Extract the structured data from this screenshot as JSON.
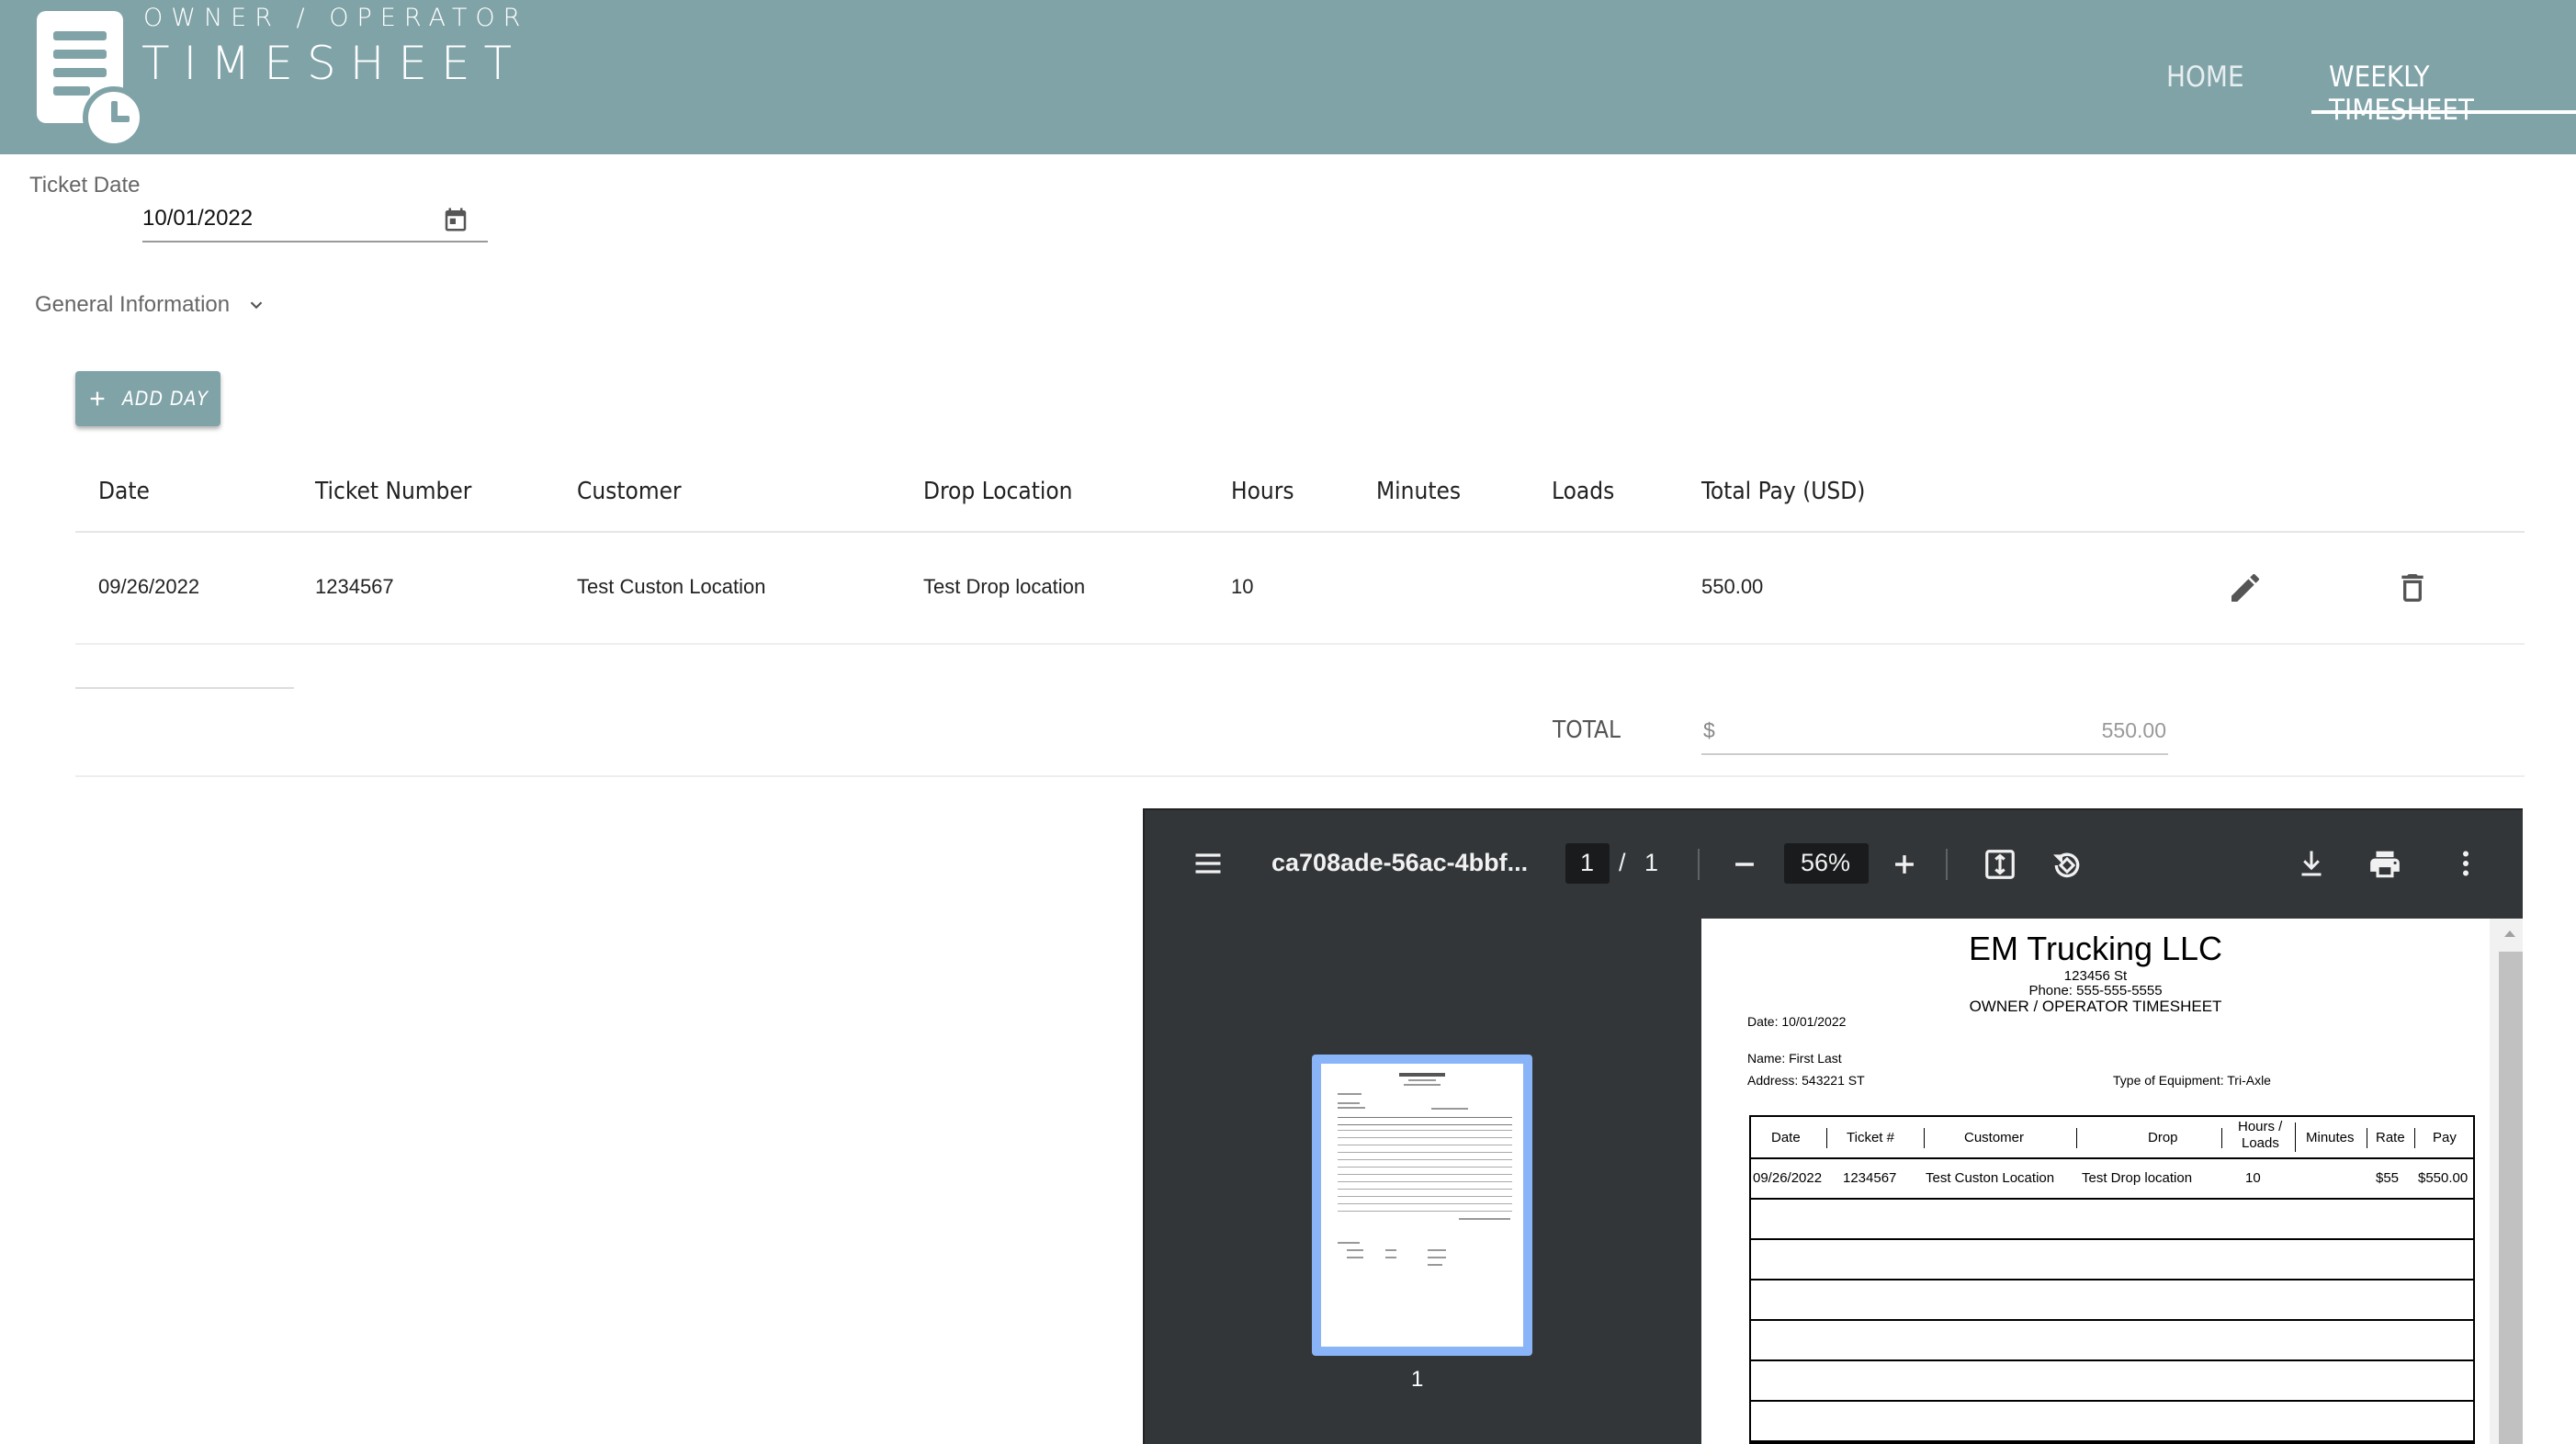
{
  "header": {
    "logo_subtitle": "OWNER / OPERATOR",
    "logo_title": "TIMESHEET",
    "nav": {
      "home": "HOME",
      "weekly": "WEEKLY TIMESHEET"
    }
  },
  "ticket_date": {
    "label": "Ticket Date",
    "value": "10/01/2022"
  },
  "general_info": {
    "label": "General Information"
  },
  "add_day_button": {
    "label": "ADD DAY"
  },
  "table": {
    "headers": [
      "Date",
      "Ticket Number",
      "Customer",
      "Drop Location",
      "Hours",
      "Minutes",
      "Loads",
      "Total Pay (USD)"
    ],
    "rows": [
      {
        "date": "09/26/2022",
        "ticket": "1234567",
        "customer": "Test Custon Location",
        "drop": "Test Drop location",
        "hours": "10",
        "minutes": "",
        "loads": "",
        "total_pay": "550.00"
      }
    ]
  },
  "total": {
    "label": "TOTAL",
    "currency": "$",
    "value": "550.00"
  },
  "pdf_viewer": {
    "filename": "ca708ade-56ac-4bbf...",
    "page_current": "1",
    "page_sep": "/",
    "page_total": "1",
    "zoom": "56%",
    "thumbnail_number": "1",
    "document": {
      "company": "EM Trucking LLC",
      "street": "123456 St",
      "phone": "Phone: 555-555-5555",
      "doc_title": "OWNER / OPERATOR TIMESHEET",
      "date": "Date: 10/01/2022",
      "name": "Name: First Last",
      "address": "Address: 543221 ST",
      "equipment": "Type of Equipment: Tri-Axle",
      "headers": {
        "date": "Date",
        "ticket": "Ticket #",
        "customer": "Customer",
        "drop": "Drop",
        "hours_1": "Hours /",
        "hours_2": "Loads",
        "minutes": "Minutes",
        "rate": "Rate",
        "pay": "Pay"
      },
      "row": {
        "date": "09/26/2022",
        "ticket": "1234567",
        "customer": "Test Custon Location",
        "drop": "Test Drop location",
        "hours": "10",
        "rate": "$55",
        "pay": "$550.00"
      }
    }
  },
  "colors": {
    "header_bg": "#80a3a8",
    "pdf_toolbar": "#323639",
    "thumb_border": "#8ab4f8"
  }
}
